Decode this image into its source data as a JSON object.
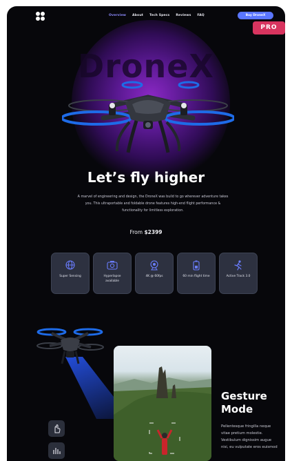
{
  "nav": {
    "links": [
      "Overview",
      "About",
      "Tech Specs",
      "Reviews",
      "FAQ"
    ],
    "active_index": 0,
    "buy_label": "Buy DroneX"
  },
  "badge": {
    "label": "PRO"
  },
  "hero": {
    "brand_word": "DroneX",
    "headline": "Let’s fly higher",
    "description": "A marvel of engineering and design, the DroneX was build to go wherever adventure takes you. This ultraportable and foldable drone features high-end flight performance & functionality for limitless exploration.",
    "price_prefix": "From ",
    "price_value": "$2399"
  },
  "features": [
    {
      "icon": "globe-icon",
      "label": "Super Sensing"
    },
    {
      "icon": "camera-icon",
      "label": "Hyperlapse available"
    },
    {
      "icon": "webcam-icon",
      "label": "4K @ 60fps"
    },
    {
      "icon": "battery-icon",
      "label": "60 min flight time"
    },
    {
      "icon": "running-person-icon",
      "label": "Active Track 3.0"
    }
  ],
  "gesture": {
    "title_line1": "Gesture",
    "title_line2": "Mode",
    "text": "Pellentesque fringilla neque vitae pretium molestie. Vestibulum dignissim augue nisi, eu vulputate eros euismod"
  },
  "colors": {
    "background": "#07070b",
    "accent": "#5a76ff",
    "nav_active": "#8f8cff",
    "badge": "#d8345f",
    "card": "#2d3140",
    "glow": "#8a28c4"
  }
}
